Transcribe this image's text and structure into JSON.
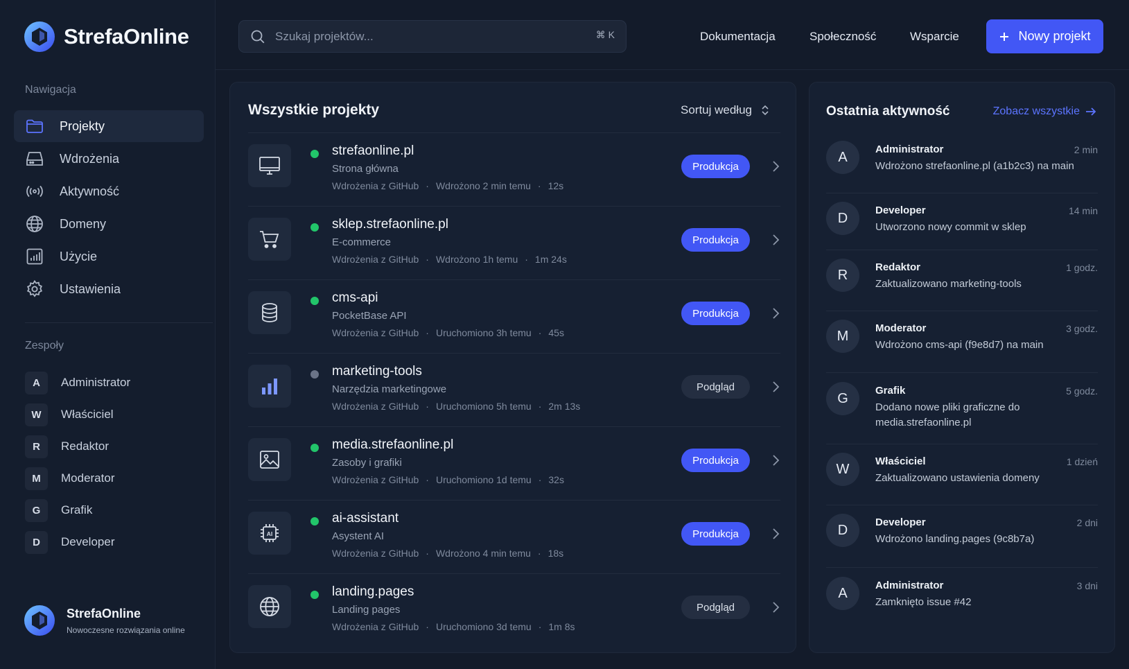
{
  "brand": {
    "name": "StrefaOnline"
  },
  "sidebar": {
    "nav_title": "Nawigacja",
    "nav": [
      {
        "label": "Projekty",
        "icon": "folder-icon"
      },
      {
        "label": "Wdrożenia",
        "icon": "server-icon"
      },
      {
        "label": "Aktywność",
        "icon": "broadcast-icon"
      },
      {
        "label": "Domeny",
        "icon": "globe-icon"
      },
      {
        "label": "Użycie",
        "icon": "bar-chart-icon"
      },
      {
        "label": "Ustawienia",
        "icon": "gear-icon"
      }
    ],
    "teams_title": "Zespoły",
    "teams": [
      {
        "initial": "A",
        "label": "Administrator"
      },
      {
        "initial": "W",
        "label": "Właściciel"
      },
      {
        "initial": "R",
        "label": "Redaktor"
      },
      {
        "initial": "M",
        "label": "Moderator"
      },
      {
        "initial": "G",
        "label": "Grafik"
      },
      {
        "initial": "D",
        "label": "Developer"
      }
    ],
    "footer": {
      "name": "StrefaOnline",
      "tagline": "Nowoczesne rozwiązania online"
    }
  },
  "topbar": {
    "search_placeholder": "Szukaj projektów...",
    "shortcut": "⌘ K",
    "links": [
      "Dokumentacja",
      "Społeczność",
      "Wsparcie"
    ],
    "new_button": "Nowy projekt"
  },
  "projects": {
    "title": "Wszystkie projekty",
    "sort_label": "Sortuj według",
    "items": [
      {
        "name": "strefaonline.pl",
        "desc": "Strona główna",
        "source": "Wdrożenia z GitHub",
        "status": "Wdrożono 2 min temu",
        "duration": "12s",
        "badge": "Produkcja",
        "icon": "monitor-icon",
        "active": true
      },
      {
        "name": "sklep.strefaonline.pl",
        "desc": "E-commerce",
        "source": "Wdrożenia z GitHub",
        "status": "Wdrożono 1h temu",
        "duration": "1m 24s",
        "badge": "Produkcja",
        "icon": "cart-icon",
        "active": true
      },
      {
        "name": "cms-api",
        "desc": "PocketBase API",
        "source": "Wdrożenia z GitHub",
        "status": "Uruchomiono 3h temu",
        "duration": "45s",
        "badge": "Produkcja",
        "icon": "database-icon",
        "active": true
      },
      {
        "name": "marketing-tools",
        "desc": "Narzędzia marketingowe",
        "source": "Wdrożenia z GitHub",
        "status": "Uruchomiono 5h temu",
        "duration": "2m 13s",
        "badge": "Podgląd",
        "icon": "bar-chart-icon",
        "active": false
      },
      {
        "name": "media.strefaonline.pl",
        "desc": "Zasoby i grafiki",
        "source": "Wdrożenia z GitHub",
        "status": "Uruchomiono 1d temu",
        "duration": "32s",
        "badge": "Produkcja",
        "icon": "image-icon",
        "active": true
      },
      {
        "name": "ai-assistant",
        "desc": "Asystent AI",
        "source": "Wdrożenia z GitHub",
        "status": "Wdrożono 4 min temu",
        "duration": "18s",
        "badge": "Produkcja",
        "icon": "ai-chip-icon",
        "active": true
      },
      {
        "name": "landing.pages",
        "desc": "Landing pages",
        "source": "Wdrożenia z GitHub",
        "status": "Uruchomiono 3d temu",
        "duration": "1m 8s",
        "badge": "Podgląd",
        "icon": "globe-icon",
        "active": true
      }
    ]
  },
  "activity": {
    "title": "Ostatnia aktywność",
    "see_all": "Zobacz wszystkie",
    "items": [
      {
        "initial": "A",
        "user": "Administrator",
        "time": "2 min",
        "msg": "Wdrożono strefaonline.pl (a1b2c3) na main"
      },
      {
        "initial": "D",
        "user": "Developer",
        "time": "14 min",
        "msg": "Utworzono nowy commit w sklep"
      },
      {
        "initial": "R",
        "user": "Redaktor",
        "time": "1 godz.",
        "msg": "Zaktualizowano marketing-tools"
      },
      {
        "initial": "M",
        "user": "Moderator",
        "time": "3 godz.",
        "msg": "Wdrożono cms-api (f9e8d7) na main"
      },
      {
        "initial": "G",
        "user": "Grafik",
        "time": "5 godz.",
        "msg": "Dodano nowe pliki graficzne do media.strefaonline.pl"
      },
      {
        "initial": "W",
        "user": "Właściciel",
        "time": "1 dzień",
        "msg": "Zaktualizowano ustawienia domeny"
      },
      {
        "initial": "D",
        "user": "Developer",
        "time": "2 dni",
        "msg": "Wdrożono landing.pages (9c8b7a)"
      },
      {
        "initial": "A",
        "user": "Administrator",
        "time": "3 dni",
        "msg": "Zamknięto issue #42"
      }
    ]
  },
  "colors": {
    "accent": "#4257f5",
    "status_active": "#22c56a",
    "status_inactive": "#6b7488",
    "link": "#5c74ff"
  }
}
